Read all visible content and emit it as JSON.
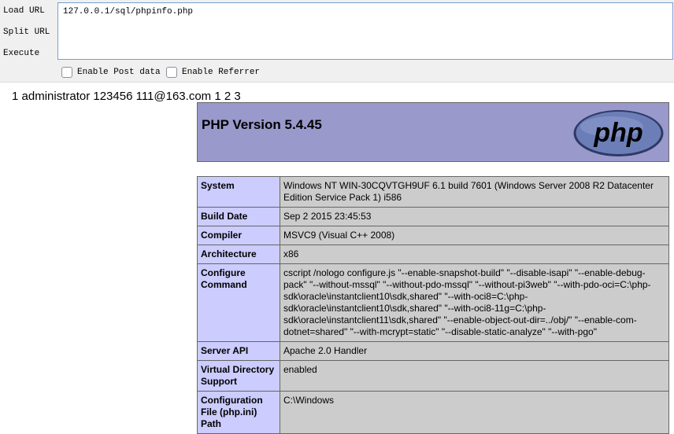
{
  "hackbar": {
    "load_label": "Load URL",
    "split_label": "Split URL",
    "execute_label": "Execute",
    "url_value": "127.0.0.1/sql/phpinfo.php",
    "post_label": "Enable Post data",
    "referrer_label": "Enable Referrer"
  },
  "output_line": "1 administrator 123456 111@163.com 1 2 3",
  "phpinfo": {
    "title": "PHP Version 5.4.45",
    "logo_text": "php",
    "rows": [
      {
        "key": "System",
        "value": "Windows NT WIN-30CQVTGH9UF 6.1 build 7601 (Windows Server 2008 R2 Datacenter Edition Service Pack 1) i586"
      },
      {
        "key": "Build Date",
        "value": "Sep 2 2015 23:45:53"
      },
      {
        "key": "Compiler",
        "value": "MSVC9 (Visual C++ 2008)"
      },
      {
        "key": "Architecture",
        "value": "x86"
      },
      {
        "key": "Configure Command",
        "value": "cscript /nologo configure.js \"--enable-snapshot-build\" \"--disable-isapi\" \"--enable-debug-pack\" \"--without-mssql\" \"--without-pdo-mssql\" \"--without-pi3web\" \"--with-pdo-oci=C:\\php-sdk\\oracle\\instantclient10\\sdk,shared\" \"--with-oci8=C:\\php-sdk\\oracle\\instantclient10\\sdk,shared\" \"--with-oci8-11g=C:\\php-sdk\\oracle\\instantclient11\\sdk,shared\" \"--enable-object-out-dir=../obj/\" \"--enable-com-dotnet=shared\" \"--with-mcrypt=static\" \"--disable-static-analyze\" \"--with-pgo\""
      },
      {
        "key": "Server API",
        "value": "Apache 2.0 Handler"
      },
      {
        "key": "Virtual Directory Support",
        "value": "enabled"
      },
      {
        "key": "Configuration File (php.ini) Path",
        "value": "C:\\Windows"
      }
    ]
  },
  "colors": {
    "header_bg": "#9999cc",
    "key_bg": "#ccccff",
    "value_bg": "#cccccc",
    "logo_bg": "#6c7eb7"
  }
}
